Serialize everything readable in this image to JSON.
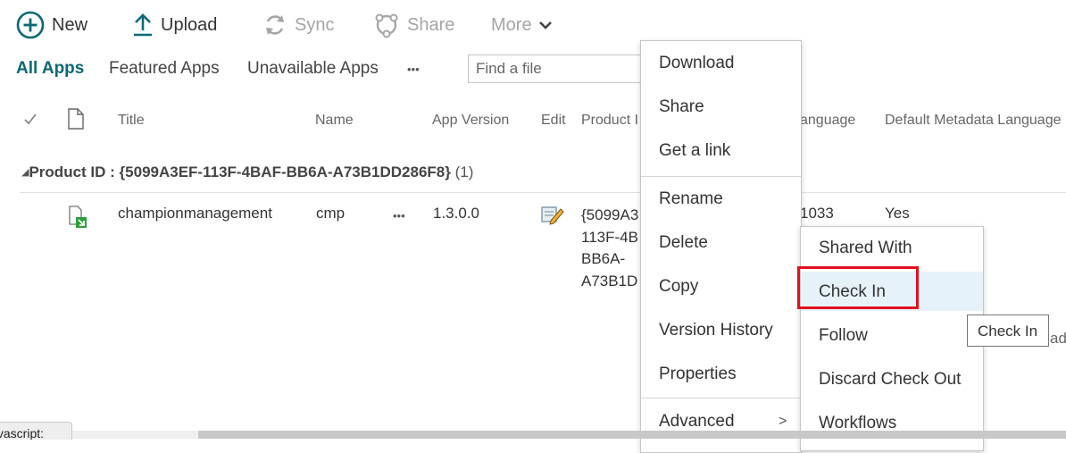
{
  "commands": {
    "new": "New",
    "upload": "Upload",
    "sync": "Sync",
    "share": "Share",
    "more": "More"
  },
  "views": {
    "all_apps": "All Apps",
    "featured_apps": "Featured Apps",
    "unavailable_apps": "Unavailable Apps",
    "ellipsis": "•••"
  },
  "search": {
    "placeholder": "Find a file"
  },
  "columns": {
    "title": "Title",
    "name": "Name",
    "app_version": "App Version",
    "edit": "Edit",
    "product_id": "Product I",
    "language": "anguage",
    "default_metadata_language": "Default Metadata Language"
  },
  "group": {
    "label": "Product ID :",
    "value": "{5099A3EF-113F-4BAF-BB6A-A73B1DD286F8}",
    "count": "(1)"
  },
  "row": {
    "title": "championmanagement",
    "name": "cmp",
    "ellipsis": "•••",
    "app_version": "1.3.0.0",
    "product_id_lines": [
      "{5099A3",
      "113F-4B",
      "BB6A-",
      "A73B1D"
    ],
    "language": "1033",
    "default_metadata": "Yes",
    "trailing": "ad"
  },
  "context_menu": {
    "items": [
      "Download",
      "Share",
      "Get a link",
      "Rename",
      "Delete",
      "Copy",
      "Version History",
      "Properties",
      "Advanced"
    ],
    "advanced_arrow": ">"
  },
  "submenu": {
    "items": [
      "Shared With",
      "Check In",
      "Follow",
      "Discard Check Out",
      "Workflows"
    ]
  },
  "tooltip": "Check In",
  "status_bar": "javascript:",
  "colors": {
    "accent": "#0b6a74",
    "highlight": "#e6f2fa",
    "annotation": "#e3101e"
  }
}
